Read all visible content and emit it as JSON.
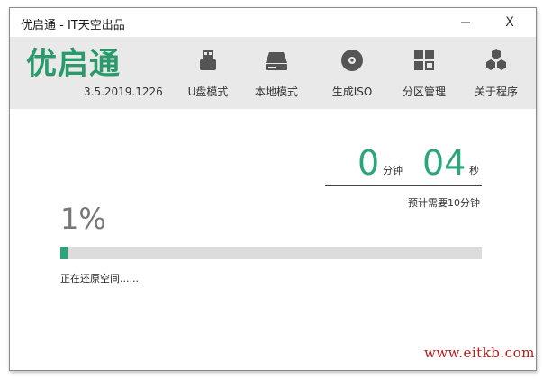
{
  "window": {
    "title": "优启通 - IT天空出品",
    "minimize_label": "—",
    "close_label": "X"
  },
  "header": {
    "logo_text": "优启通",
    "version": "3.5.2019.1226",
    "nav": [
      {
        "label": "U盘模式",
        "icon": "usb-drive-icon"
      },
      {
        "label": "本地模式",
        "icon": "hard-disk-icon"
      },
      {
        "label": "生成ISO",
        "icon": "disc-icon"
      },
      {
        "label": "分区管理",
        "icon": "partition-grid-icon"
      },
      {
        "label": "关于程序",
        "icon": "hexagon-cluster-icon"
      }
    ]
  },
  "progress": {
    "minutes": "0",
    "minutes_unit": "分钟",
    "seconds": "04",
    "seconds_unit": "秒",
    "estimate": "预计需要10分钟",
    "percent_text": "1%",
    "percent_value": 1,
    "status": "正在还原空间......"
  },
  "watermark": "www.eitkb.com",
  "colors": {
    "accent": "#2aa57c",
    "logo": "#2a9a6c",
    "header_bg": "#e9e9e9",
    "watermark": "#b81c1c"
  }
}
